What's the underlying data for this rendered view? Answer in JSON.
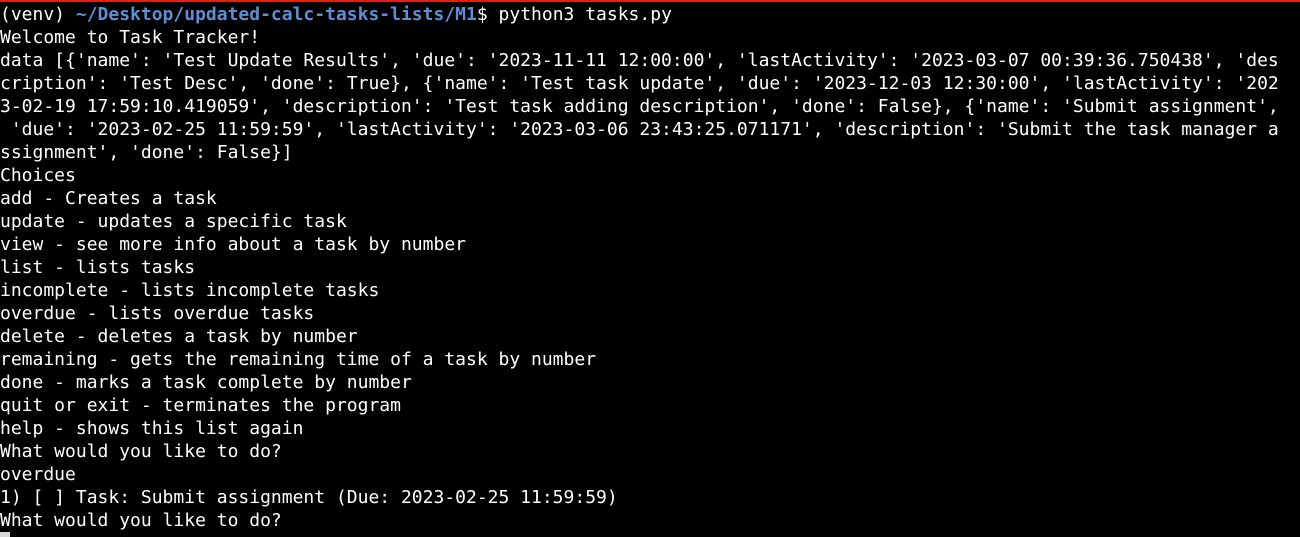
{
  "terminal": {
    "prompt_venv": "(venv) ",
    "prompt_path": "~/Desktop/updated-calc-tasks-lists/M1",
    "prompt_symbol": "$ ",
    "command": "python3 tasks.py",
    "output_lines": [
      "Welcome to Task Tracker!",
      "data [{'name': 'Test Update Results', 'due': '2023-11-11 12:00:00', 'lastActivity': '2023-03-07 00:39:36.750438', 'des",
      "cription': 'Test Desc', 'done': True}, {'name': 'Test task update', 'due': '2023-12-03 12:30:00', 'lastActivity': '202",
      "3-02-19 17:59:10.419059', 'description': 'Test task adding description', 'done': False}, {'name': 'Submit assignment',",
      " 'due': '2023-02-25 11:59:59', 'lastActivity': '2023-03-06 23:43:25.071171', 'description': 'Submit the task manager a",
      "ssignment', 'done': False}]",
      "Choices",
      "add - Creates a task",
      "update - updates a specific task",
      "view - see more info about a task by number",
      "list - lists tasks",
      "incomplete - lists incomplete tasks",
      "overdue - lists overdue tasks",
      "delete - deletes a task by number",
      "remaining - gets the remaining time of a task by number",
      "done - marks a task complete by number",
      "quit or exit - terminates the program",
      "help - shows this list again",
      "What would you like to do?",
      "overdue",
      "1) [ ] Task: Submit assignment (Due: 2023-02-25 11:59:59)",
      "What would you like to do?"
    ],
    "colors": {
      "background": "#000000",
      "text": "#ffffff",
      "path": "#5c8fd6",
      "top_accent": "#d8231a",
      "cursor": "#d8d8d8"
    }
  }
}
